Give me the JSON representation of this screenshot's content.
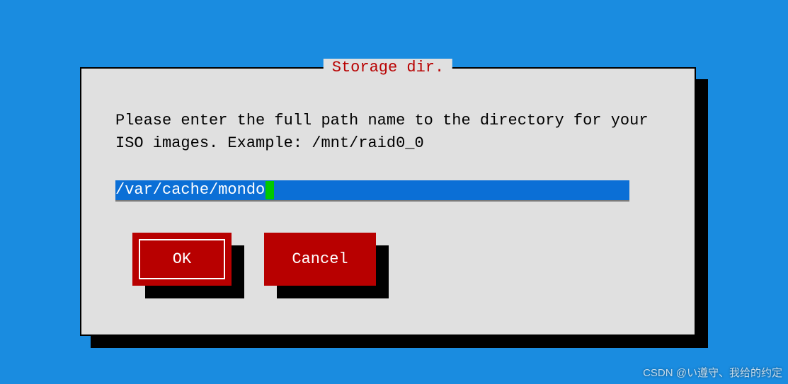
{
  "dialog": {
    "title": " Storage dir. ",
    "body": "Please enter the full path name to the directory for your ISO images.  Example: /mnt/raid0_0",
    "input_value": "/var/cache/mondo",
    "ok_label": "OK",
    "cancel_label": "Cancel"
  },
  "watermark": "CSDN @い遵守、我给的约定"
}
